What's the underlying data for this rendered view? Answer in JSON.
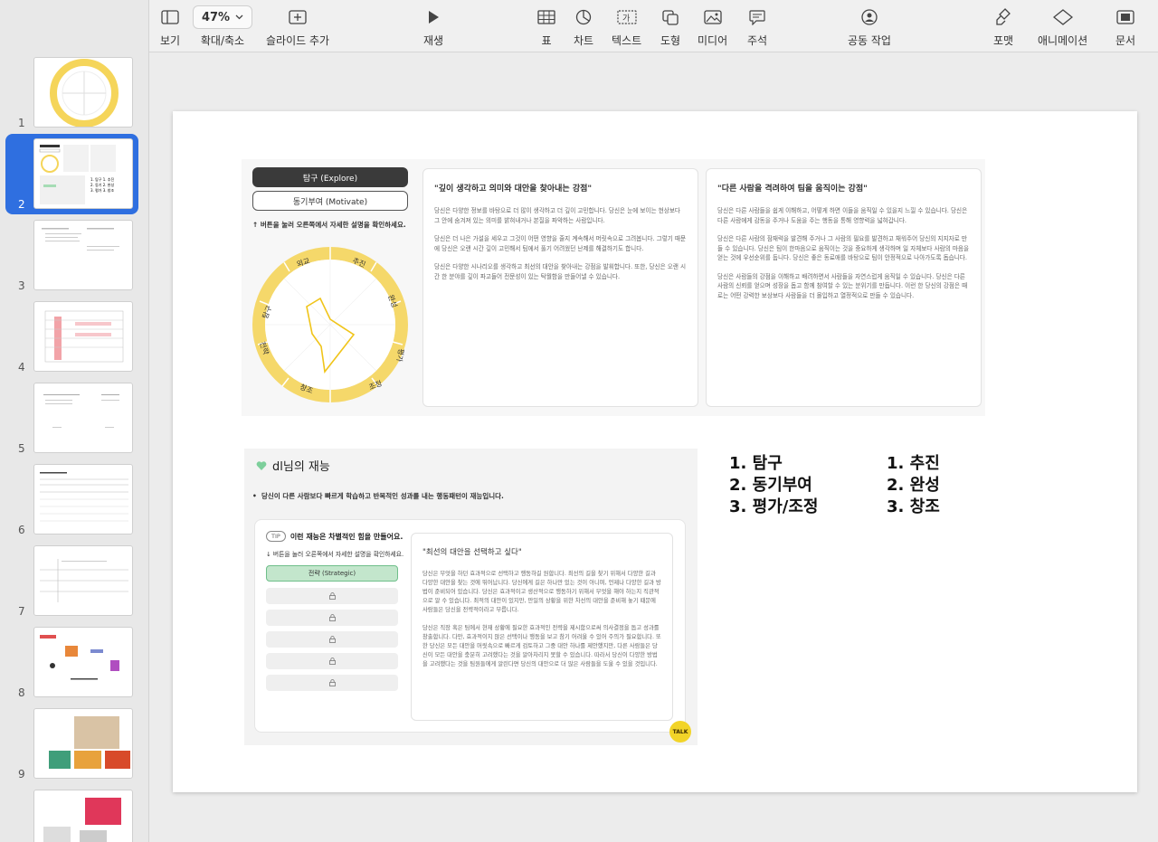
{
  "toolbar": {
    "view": "보기",
    "zoom_value": "47%",
    "zoom": "확대/축소",
    "add_slide": "슬라이드 추가",
    "play": "재생",
    "table": "표",
    "chart": "차트",
    "text": "텍스트",
    "shape": "도형",
    "media": "미디어",
    "comment": "주석",
    "collaborate": "공동 작업",
    "format": "포맷",
    "animate": "애니메이션",
    "document": "문서"
  },
  "sidebar": {
    "slides": [
      "1",
      "2",
      "3",
      "4",
      "5",
      "6",
      "7",
      "8",
      "9"
    ],
    "selected": "2"
  },
  "slide": {
    "tab_active": "탐구 (Explore)",
    "tab_inactive": "동기부여 (Motivate)",
    "hint": "버튼을 눌러 오른쪽에서 자세한 설명을 확인하세요.",
    "radar_labels": [
      "추진",
      "완성",
      "평가",
      "조정",
      "창조",
      "전략",
      "탐구",
      "동기부여",
      "외교"
    ],
    "card1": {
      "title": "\"깊이 생각하고 의미와 대안을 찾아내는 강점\"",
      "p1": "당신은 다양한 정보를 바탕으로 더 많이 생각하고 더 깊이 고민합니다. 당신은 눈에 보이는 현상보다 그 안에 숨겨져 있는 의미를 밝혀내거나 본질을 파악하는 사람입니다.",
      "p2": "당신은 더 나은 가설을 세우고 그것이 어떤 영향을 줄지 계속해서 머릿속으로 그려봅니다. 그렇기 때문에 당신은 오랜 시간 깊이 고민해서 팀에서 풀기 어려웠던 난제를 해결하기도 합니다.",
      "p3": "당신은 다양한 시나리오를 생각하고 최선의 대안을 찾아내는 강점을 발휘합니다. 또한, 당신은 오랜 시간 한 분야를 깊이 파고들어 전문성이 있는 탁월함을 만들어낼 수 있습니다."
    },
    "card2": {
      "title": "\"다른 사람을 격려하여 팀을 움직이는 강점\"",
      "p1": "당신은 다른 사람들을 쉽게 이해하고, 어떻게 하면 이들을 움직일 수 있을지 느낄 수 있습니다. 당신은 다른 사람에게 감동을 주거나 도움을 주는 행동을 통해 영향력을 넓혀갑니다.",
      "p2": "당신은 다른 사람의 잠재력을 발견해 주거나 그 사람의 필요를 발견하고 채워주어 당신의 지지자로 만들 수 있습니다. 당신은 팀이 한마음으로 움직이는 것을 중요하게 생각하며 일 자체보다 사람의 마음을 얻는 것에 우선순위를 둡니다. 당신은 좋은 동료애를 바탕으로 팀이 안정적으로 나아가도록 돕습니다.",
      "p3": "당신은 사람들의 강점을 이해하고 배려하면서 사람들을 자연스럽게 움직일 수 있습니다. 당신은 다른 사람의 신뢰를 얻으며 성장을 돕고 함께 참여할 수 있는 분위기를 만듭니다. 이런 한 당신의 강점은 때로는 어떤 강력한 보상보다 사람들을 더 몰입하고 열정적으로 만들 수 있습니다."
    },
    "talent_title": "dl님의 재능",
    "talent_sub": "당신이 다른 사람보다 빠르게 학습하고 반복적인 성과를 내는 행동패턴이 재능입니다.",
    "tip_badge": "TIP",
    "tip_text": "이런 재능은 차별적인 힘을 만들어요.",
    "hint2": "버튼을 눌러 오른쪽에서 자세한 설명을 확인하세요.",
    "strategic": "전략 (Strategic)",
    "card3": {
      "title": "\"최선의 대안을 선택하고 싶다\"",
      "p1": "당신은 무엇을 하던 효과적으로 선택하고 행동하길 원합니다. 최선의 길을 찾기 위해서 다양한 길과 다양한 대안을 찾는 것에 뛰어납니다. 당신에게 길은 하나만 있는 것이 아니며, 언제나 다양한 길과 방법이 준비되어 있습니다. 당신은 효과적이고 생산적으로 행동하기 위해서 무엇을 해야 하는지 직관적으로 알 수 있습니다. 최적의 대안이 있지만, 만일의 상황을 위한 차선의 대안을 준비해 놓기 때문에 사람들은 당신을 전략적이라고 부릅니다.",
      "p2": "당신은 직장 혹은 팀에서 현재 상황에 필요한 효과적인 전략을 제시함으로써 의사결정을 돕고 성과를 창출합니다. 다만, 효과적이지 않은 선택이나 행동을 보고 참기 어려울 수 있어 주의가 필요합니다. 또한 당신은 모든 대안을 머릿속으로 빠르게 검토하고 그중 대안 하나를 제안했지만, 다른 사람들은 당신이 모든 대안을 충분히 고려했다는 것을 알아차리지 못할 수 있습니다. 따라서 당신이 다양한 방법을 고려했다는 것을 팀원들에게 알린다면 당신의 대안으로 더 많은 사람들을 도울 수 있을 것입니다."
    },
    "talk": "TALK",
    "list_left": [
      "1.  탐구",
      "2.  동기부여",
      "3.  평가/조정"
    ],
    "list_right": [
      "1.  추진",
      "2.  완성",
      "3.  창조"
    ]
  }
}
